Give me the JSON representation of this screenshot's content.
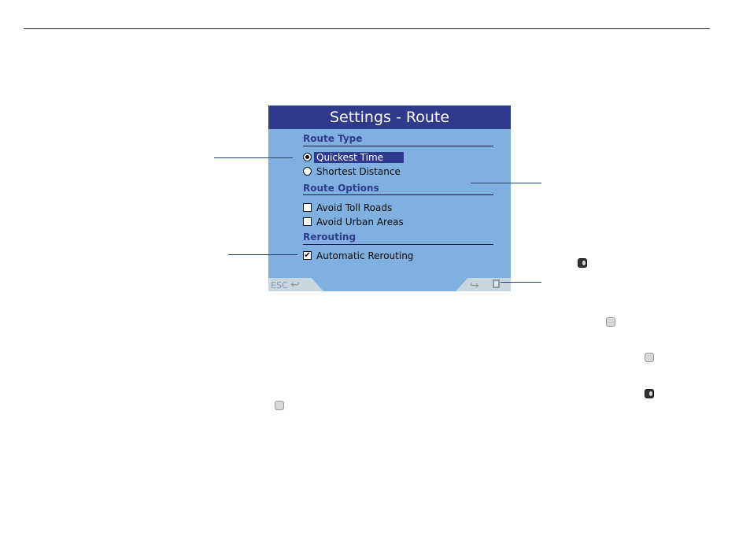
{
  "screen": {
    "title": "Settings - Route",
    "sections": {
      "route_type": "Route Type",
      "route_options": "Route Options",
      "rerouting": "Rerouting"
    },
    "options": {
      "quickest_time": "Quickest Time",
      "shortest_distance": "Shortest Distance",
      "avoid_toll_roads": "Avoid Toll Roads",
      "avoid_urban_areas": "Avoid Urban Areas",
      "automatic_rerouting": "Automatic Rerouting"
    },
    "checked_mark": "✔",
    "footer": {
      "esc_label": "ESC",
      "esc_arrow": "↩",
      "next_arrow": "↪"
    }
  },
  "icons": {
    "page_icon": "page-icon",
    "map_dark": "map-dark-icon",
    "map_light": "map-light-icon"
  }
}
